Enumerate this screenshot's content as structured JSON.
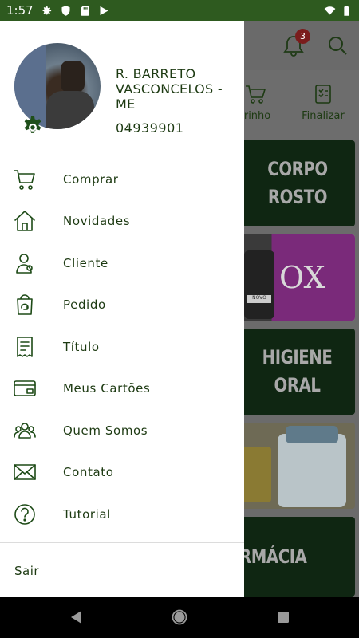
{
  "status_bar": {
    "time": "1:57"
  },
  "background": {
    "notifications_badge": "3",
    "tabs": [
      {
        "label": "rrinho",
        "icon": "cart-icon"
      },
      {
        "label": "Finalizar",
        "icon": "checklist-icon"
      }
    ],
    "banners": [
      {
        "line1": "CORPO",
        "line2": "ROSTO"
      },
      {
        "label": "OX"
      },
      {
        "line1": "HIGIENE",
        "line2": "ORAL"
      },
      {
        "label": ""
      },
      {
        "line1": "RMÁCIA"
      }
    ]
  },
  "drawer": {
    "profile": {
      "name": "R. BARRETO VASCONCELOS - ME",
      "code": "04939901"
    },
    "menu": [
      {
        "label": "Comprar",
        "icon": "cart-icon"
      },
      {
        "label": "Novidades",
        "icon": "house-icon"
      },
      {
        "label": "Cliente",
        "icon": "client-icon"
      },
      {
        "label": "Pedido",
        "icon": "order-bag-icon"
      },
      {
        "label": "Título",
        "icon": "receipt-icon"
      },
      {
        "label": "Meus Cartões",
        "icon": "credit-card-icon"
      },
      {
        "label": "Quem Somos",
        "icon": "group-icon"
      },
      {
        "label": "Contato",
        "icon": "envelope-icon"
      },
      {
        "label": "Tutorial",
        "icon": "question-icon"
      }
    ],
    "logout_label": "Sair"
  },
  "colors": {
    "brand": "#2e5a1f",
    "menu_text": "#1d3a12",
    "badge": "#7a1c1c"
  }
}
